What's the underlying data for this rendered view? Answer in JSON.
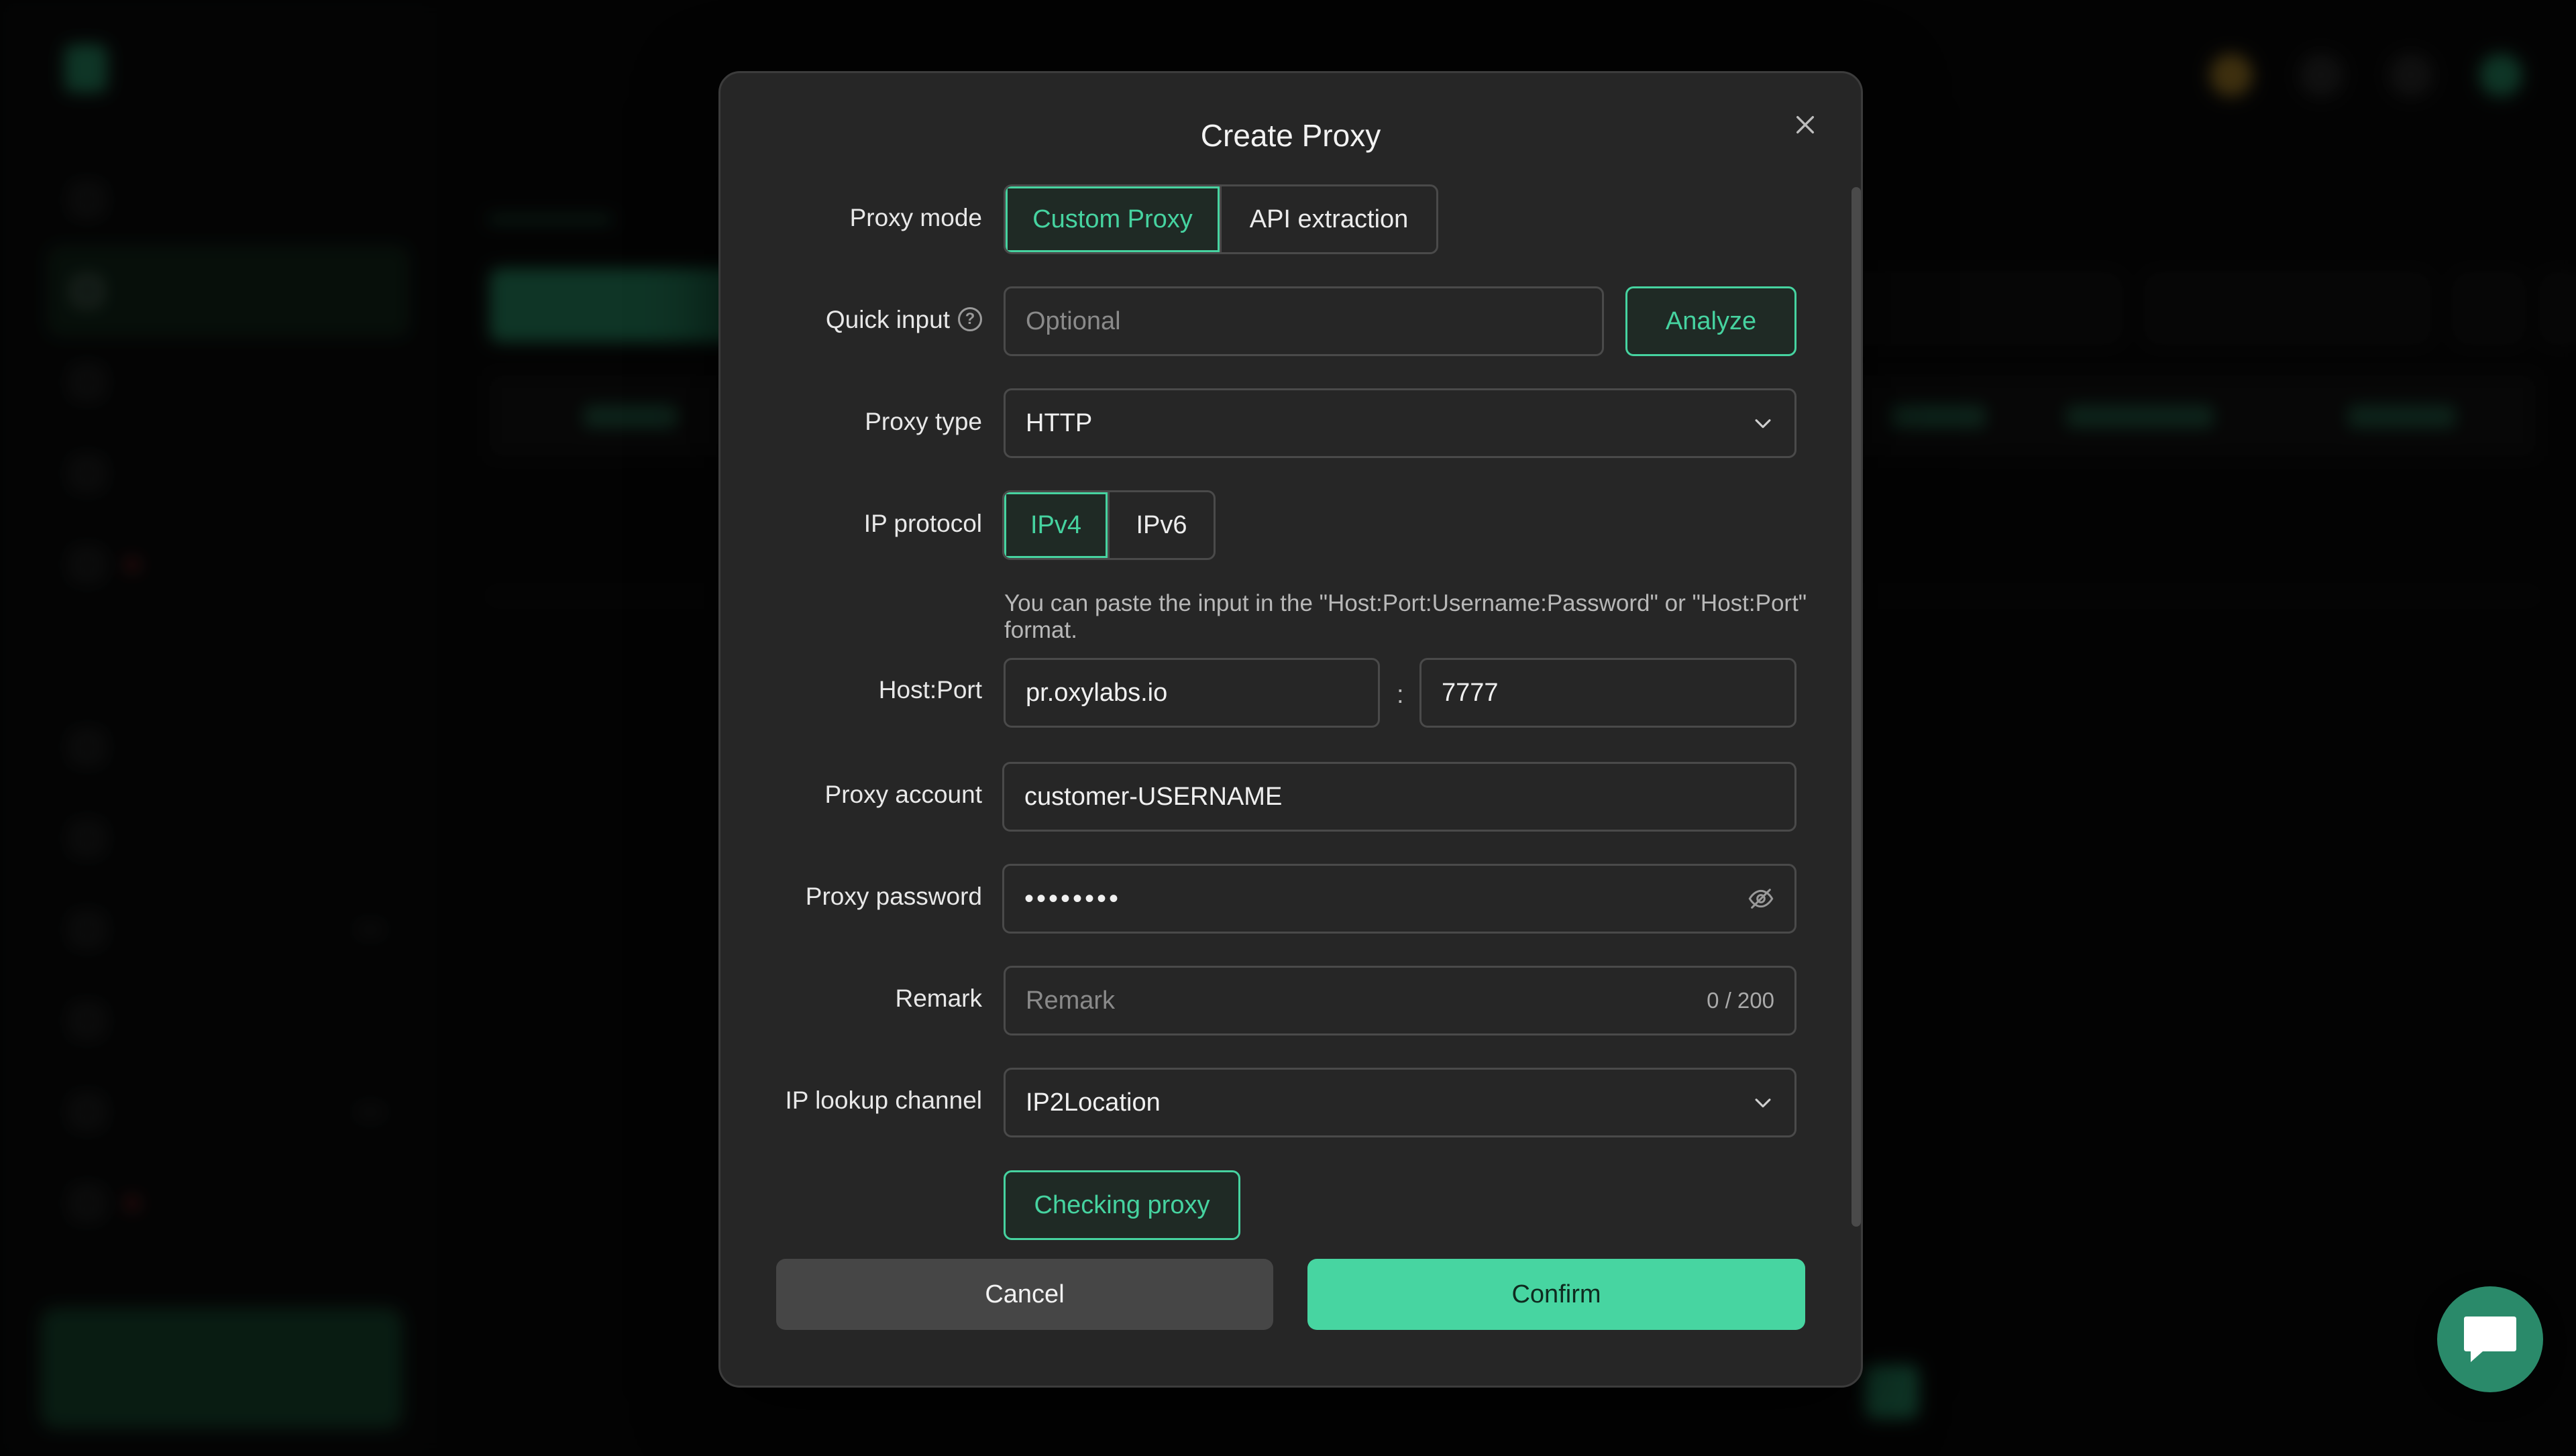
{
  "modal": {
    "title": "Create Proxy",
    "proxy_mode": {
      "label": "Proxy mode",
      "options": [
        "Custom Proxy",
        "API extraction"
      ],
      "selected": "Custom Proxy"
    },
    "quick_input": {
      "label": "Quick input",
      "help_glyph": "?",
      "placeholder": "Optional",
      "analyze_label": "Analyze"
    },
    "proxy_type": {
      "label": "Proxy type",
      "value": "HTTP"
    },
    "ip_protocol": {
      "label": "IP protocol",
      "options": [
        "IPv4",
        "IPv6"
      ],
      "selected": "IPv4"
    },
    "host_port": {
      "hint": "You can paste the input in the \"Host:Port:Username:Password\" or \"Host:Port\" format.",
      "label": "Host:Port",
      "host": "pr.oxylabs.io",
      "separator": ":",
      "port": "7777"
    },
    "proxy_account": {
      "label": "Proxy account",
      "value": "customer-USERNAME"
    },
    "proxy_password": {
      "label": "Proxy password",
      "masked_value": "••••••••"
    },
    "remark": {
      "label": "Remark",
      "placeholder": "Remark",
      "counter": "0 / 200"
    },
    "ip_lookup_channel": {
      "label": "IP lookup channel",
      "value": "IP2Location"
    },
    "check_button": "Checking proxy",
    "cancel_button": "Cancel",
    "confirm_button": "Confirm"
  },
  "colors": {
    "accent": "#46d3a0",
    "confirm_bg": "#47d5a1",
    "modal_bg": "#262626",
    "border": "#4a4a4a"
  },
  "icons": [
    "close-icon",
    "help-icon",
    "chevron-down-icon",
    "eye-off-icon",
    "chat-icon"
  ]
}
